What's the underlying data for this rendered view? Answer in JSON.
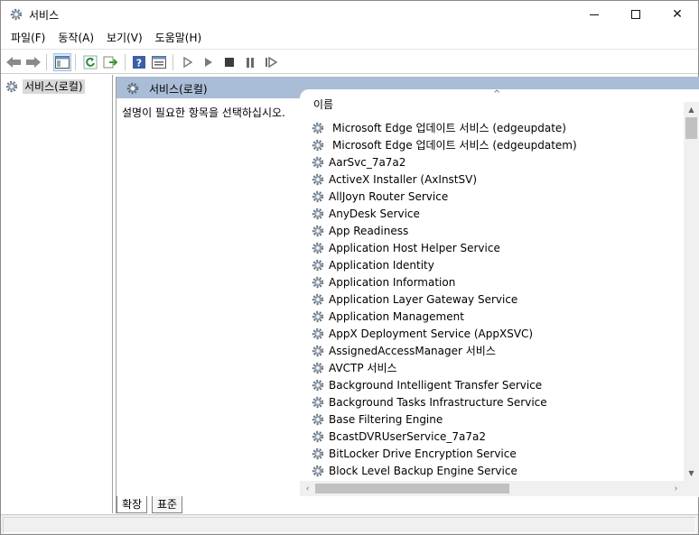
{
  "window": {
    "title": "서비스",
    "icons": {
      "app": "gear-icon",
      "minimize": "minimize-icon",
      "maximize": "maximize-icon",
      "close": "close-icon"
    },
    "close_glyph": "✕"
  },
  "menu": {
    "items": [
      "파일(F)",
      "동작(A)",
      "보기(V)",
      "도움말(H)"
    ]
  },
  "toolbar": {
    "buttons": [
      "back-arrow-icon",
      "forward-arrow-icon",
      "console-tree-icon",
      "refresh-icon",
      "export-icon",
      "help-icon",
      "properties-icon",
      "play-icon",
      "play-alt-icon",
      "stop-icon",
      "pause-icon",
      "resume-icon"
    ]
  },
  "tree": {
    "selected_label": "서비스(로컬)"
  },
  "pane": {
    "header_title": "서비스(로컬)",
    "description": "설명이 필요한 항목을 선택하십시오.",
    "header_color": "#a9bdd6"
  },
  "list": {
    "column_name": "이름",
    "sort_indicator": "^",
    "services": [
      "Microsoft Edge 업데이트 서비스 (edgeupdate)",
      "Microsoft Edge 업데이트 서비스 (edgeupdatem)",
      "AarSvc_7a7a2",
      "ActiveX Installer (AxInstSV)",
      "AllJoyn Router Service",
      "AnyDesk Service",
      "App Readiness",
      "Application Host Helper Service",
      "Application Identity",
      "Application Information",
      "Application Layer Gateway Service",
      "Application Management",
      "AppX Deployment Service (AppXSVC)",
      "AssignedAccessManager 서비스",
      "AVCTP 서비스",
      "Background Intelligent Transfer Service",
      "Background Tasks Infrastructure Service",
      "Base Filtering Engine",
      "BcastDVRUserService_7a7a2",
      "BitLocker Drive Encryption Service",
      "Block Level Backup Engine Service"
    ]
  },
  "scroll": {
    "up": "▲",
    "down": "▼",
    "left": "‹",
    "right": "›"
  },
  "tabs": {
    "extended": "확장",
    "standard": "표준"
  }
}
